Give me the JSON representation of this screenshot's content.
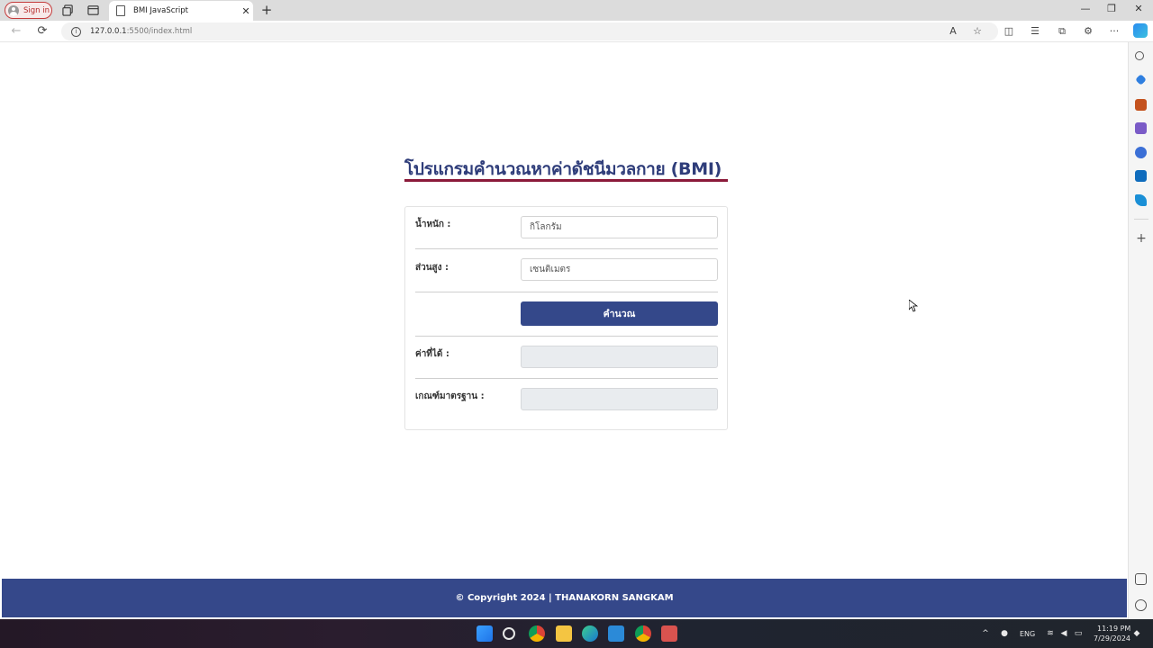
{
  "browser": {
    "profile_label": "Sign in",
    "tab_title": "BMI JavaScript",
    "url_host": "127.0.0.1",
    "url_rest": ":5500/index.html",
    "icons": {
      "workspaces": "workspaces-icon",
      "tab_actions": "tab-actions-icon",
      "page": "page-icon",
      "close": "✕",
      "new_tab": "+",
      "minimize": "—",
      "restore": "❐",
      "window_close": "✕",
      "back": "←",
      "refresh": "⟳",
      "info": "i",
      "read_aloud": "A",
      "favorite": "☆",
      "split": "◫",
      "favorites": "☰",
      "collections": "⧉",
      "extensions": "⚙",
      "more": "···"
    },
    "sidebar_add": "+"
  },
  "page": {
    "title": "โปรแกรมคำนวณหาค่าดัชนีมวลกาย (BMI)",
    "accent_color": "#34488a",
    "underline_color": "#8b1a3a",
    "form": {
      "weight_label": "น้ำหนัก :",
      "weight_placeholder": "กิโลกรัม",
      "height_label": "ส่วนสูง :",
      "height_placeholder": "เซนติเมตร",
      "calculate_label": "คำนวณ",
      "result_label": "ค่าที่ได้ :",
      "result_value": "",
      "criteria_label": "เกณฑ์มาตรฐาน :",
      "criteria_value": ""
    },
    "footer_text": "© Copyright 2024 | THANAKORN SANGKAM"
  },
  "taskbar": {
    "lang": "ENG",
    "time": "11:19 PM",
    "date": "7/29/2024",
    "chevron": "^"
  }
}
